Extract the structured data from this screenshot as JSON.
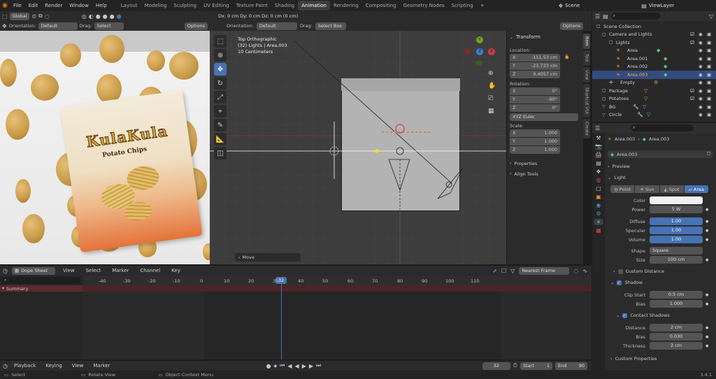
{
  "topbar": {
    "menus": [
      "File",
      "Edit",
      "Render",
      "Window",
      "Help"
    ],
    "workspaces": [
      "Layout",
      "Modeling",
      "Sculpting",
      "UV Editing",
      "Texture Paint",
      "Shading",
      "Animation",
      "Rendering",
      "Compositing",
      "Geometry Nodes",
      "Scripting"
    ],
    "active_workspace": "Animation",
    "add_tab": "+",
    "scene": "Scene",
    "view_layer": "ViewLayer"
  },
  "left_view": {
    "transform_orientation": "Global",
    "orientation_label": "Orientation:",
    "orientation_value": "Default",
    "drag_label": "Drag:",
    "drag_value": "Select Box",
    "options": "Options"
  },
  "product": {
    "brand": "KulaKula",
    "subtitle": "Potato Chips"
  },
  "viewport": {
    "header_readout": "Dx: 0 cm  Dy: 0 cm  Dz: 0 cm (0 cm)",
    "orientation_label": "Orientation:",
    "orientation_value": "Default",
    "drag_label": "Drag:",
    "drag_value": "Select Box",
    "options": "Options",
    "info_line1": "Top Orthographic",
    "info_line2": "(32) Lights | Area.003",
    "info_line3": "10 Centimeters",
    "operator_panel": "Move",
    "gizmo_y": "Y",
    "gizmo_x": "X",
    "gizmo_z": "Z"
  },
  "n_panel": {
    "transform_title": "Transform",
    "location_label": "Location:",
    "location": [
      {
        "axis": "X",
        "value": "-111.53 cm"
      },
      {
        "axis": "Y",
        "value": "-23.723 cm"
      },
      {
        "axis": "Z",
        "value": "9.4057 cm"
      }
    ],
    "rotation_label": "Rotation:",
    "rotation": [
      {
        "axis": "X",
        "value": "0°"
      },
      {
        "axis": "Y",
        "value": "-90°"
      },
      {
        "axis": "Z",
        "value": "0°"
      }
    ],
    "rotation_mode": "XYZ Euler",
    "scale_label": "Scale:",
    "scale": [
      {
        "axis": "X",
        "value": "1.000"
      },
      {
        "axis": "Y",
        "value": "1.000"
      },
      {
        "axis": "Z",
        "value": "1.000"
      }
    ],
    "properties": "Properties",
    "align_tools": "Align Tools",
    "tabs": [
      "Item",
      "Tool",
      "View",
      "Shortcut VUr",
      "Create"
    ]
  },
  "outliner": {
    "search_placeholder": "",
    "items": [
      {
        "name": "Scene Collection",
        "indent": 0
      },
      {
        "name": "Camera and Lights",
        "indent": 1
      },
      {
        "name": "Lights",
        "indent": 2
      },
      {
        "name": "Area",
        "indent": 3
      },
      {
        "name": "Area.001",
        "indent": 3
      },
      {
        "name": "Area.002",
        "indent": 3
      },
      {
        "name": "Area.003",
        "indent": 3,
        "selected": true
      },
      {
        "name": "Empty",
        "indent": 2
      },
      {
        "name": "Package",
        "indent": 1
      },
      {
        "name": "Potatoes",
        "indent": 1
      },
      {
        "name": "BG",
        "indent": 1
      },
      {
        "name": "Circle",
        "indent": 1
      }
    ]
  },
  "properties": {
    "breadcrumb_object": "Area.003",
    "breadcrumb_data": "Area.003",
    "datablock_name": "Area.003",
    "preview": "Preview",
    "light": "Light",
    "light_types": [
      "Point",
      "Sun",
      "Spot",
      "Area"
    ],
    "active_light_type": "Area",
    "color_label": "Color",
    "power_label": "Power",
    "power_value": "5 W",
    "diffuse_label": "Diffuse",
    "diffuse_value": "1.00",
    "specular_label": "Specular",
    "specular_value": "1.00",
    "volume_label": "Volume",
    "volume_value": "1.00",
    "shape_label": "Shape",
    "shape_value": "Square",
    "size_label": "Size",
    "size_value": "100 cm",
    "custom_distance": "Custom Distance",
    "shadow": "Shadow",
    "clip_start_label": "Clip Start",
    "clip_start_value": "0.5 cm",
    "bias_label": "Bias",
    "bias_value": "1.000",
    "contact_shadows": "Contact Shadows",
    "distance_label": "Distance",
    "distance_value": "2 cm",
    "cs_bias_label": "Bias",
    "cs_bias_value": "0.030",
    "thickness_label": "Thickness",
    "thickness_value": "2 cm",
    "custom_properties": "Custom Properties"
  },
  "dopesheet": {
    "editor": "Dope Sheet",
    "menus": [
      "View",
      "Select",
      "Marker",
      "Channel",
      "Key"
    ],
    "snap": "Nearest Frame",
    "summary": "Summary",
    "current_frame": "32",
    "ruler": [
      "-40",
      "-30",
      "-20",
      "-10",
      "0",
      "10",
      "20",
      "30",
      "40",
      "50",
      "60",
      "70",
      "80",
      "90",
      "100",
      "110"
    ]
  },
  "timeline": {
    "menus": [
      "Playback",
      "Keying",
      "View",
      "Marker"
    ],
    "frame": "32",
    "start_label": "Start",
    "start_value": "1",
    "end_label": "End",
    "end_value": "90"
  },
  "statusbar": {
    "select": "Select",
    "rotate": "Rotate View",
    "context": "Object Context Menu",
    "version": "3.4.1"
  },
  "colors": {
    "accent": "#4772b3",
    "header": "#232323",
    "panel": "#2b2b2b",
    "light_icon": "#e8923a"
  }
}
